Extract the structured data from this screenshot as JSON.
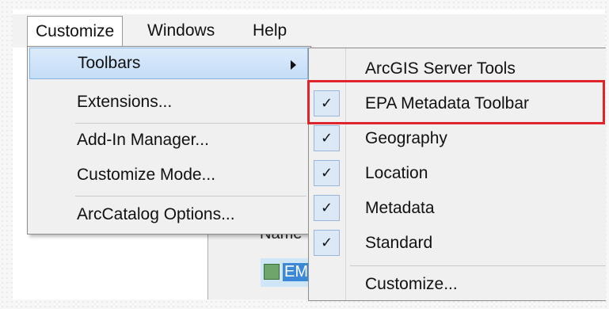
{
  "menubar": {
    "customize": "Customize",
    "windows": "Windows",
    "help": "Help"
  },
  "customize_menu": {
    "items": [
      {
        "label": "Toolbars"
      },
      {
        "label": "Extensions..."
      },
      {
        "label": "Add-In Manager..."
      },
      {
        "label": "Customize Mode..."
      },
      {
        "label": "ArcCatalog Options..."
      }
    ]
  },
  "toolbars_submenu": {
    "items": [
      {
        "label": "ArcGIS Server Tools",
        "checked": false
      },
      {
        "label": "EPA Metadata Toolbar",
        "checked": true
      },
      {
        "label": "Geography",
        "checked": true
      },
      {
        "label": "Location",
        "checked": true
      },
      {
        "label": "Metadata",
        "checked": true
      },
      {
        "label": "Standard",
        "checked": true
      },
      {
        "label": "Customize...",
        "checked": false
      }
    ],
    "check_glyph": "✓"
  },
  "background_window": {
    "column_header": "Name",
    "selected_item": "EM"
  },
  "colors": {
    "highlight": "#c4ddf7",
    "annotation_red": "#e0242e"
  }
}
